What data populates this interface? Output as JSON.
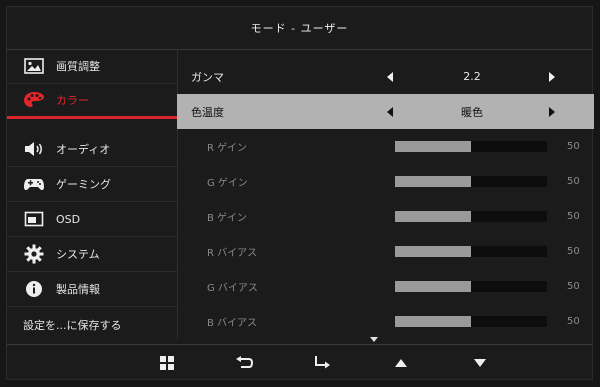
{
  "title": "モード - ユーザー",
  "sidebar": {
    "items": [
      {
        "label": "画質調整",
        "icon": "picture-icon"
      },
      {
        "label": "カラー",
        "icon": "palette-icon"
      },
      {
        "label": "オーディオ",
        "icon": "speaker-icon"
      },
      {
        "label": "ゲーミング",
        "icon": "gamepad-icon"
      },
      {
        "label": "OSD",
        "icon": "osd-icon"
      },
      {
        "label": "システム",
        "icon": "gear-icon"
      },
      {
        "label": "製品情報",
        "icon": "info-icon"
      }
    ],
    "save_label": "設定を...に保存する"
  },
  "settings": {
    "gamma": {
      "label": "ガンマ",
      "value": "2.2"
    },
    "color_temp": {
      "label": "色温度",
      "value": "暖色"
    },
    "r_gain": {
      "label": "R ゲイン",
      "value": "50",
      "fraction": 0.5
    },
    "g_gain": {
      "label": "G ゲイン",
      "value": "50",
      "fraction": 0.5
    },
    "b_gain": {
      "label": "B ゲイン",
      "value": "50",
      "fraction": 0.5
    },
    "r_bias": {
      "label": "R バイアス",
      "value": "50",
      "fraction": 0.5
    },
    "g_bias": {
      "label": "G バイアス",
      "value": "50",
      "fraction": 0.5
    },
    "b_bias": {
      "label": "B バイアス",
      "value": "50",
      "fraction": 0.5
    }
  },
  "colors": {
    "accent": "#d9262a",
    "selected_row": "#b2b2b2",
    "background": "#1b1b1b"
  },
  "bottom_buttons": [
    "menu-grid-icon",
    "return-icon",
    "enter-icon",
    "up-arrow-icon",
    "down-arrow-icon"
  ]
}
